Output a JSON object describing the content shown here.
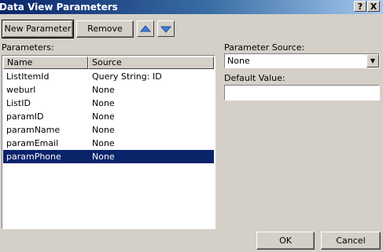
{
  "window": {
    "title": "Data View Parameters",
    "help_label": "?",
    "close_label": "X"
  },
  "toolbar": {
    "new_parameter_label": "New Parameter",
    "remove_label": "Remove",
    "move_up_icon": "arrow-up-icon",
    "move_down_icon": "arrow-down-icon"
  },
  "parameters": {
    "label": "Parameters:",
    "columns": [
      "Name",
      "Source"
    ],
    "rows": [
      {
        "name": "ListItemId",
        "source": "Query String: ID"
      },
      {
        "name": "weburl",
        "source": "None"
      },
      {
        "name": "ListID",
        "source": "None"
      },
      {
        "name": "paramID",
        "source": "None"
      },
      {
        "name": "paramName",
        "source": "None"
      },
      {
        "name": "paramEmail",
        "source": "None"
      },
      {
        "name": "paramPhone",
        "source": "None"
      }
    ],
    "selected_index": 6
  },
  "parameter_source": {
    "label": "Parameter Source:",
    "selected": "None"
  },
  "default_value": {
    "label": "Default Value:",
    "value": ""
  },
  "footer": {
    "ok_label": "OK",
    "cancel_label": "Cancel"
  },
  "colors": {
    "selection": "#0a246a",
    "dialog_bg": "#d4d0c8"
  }
}
